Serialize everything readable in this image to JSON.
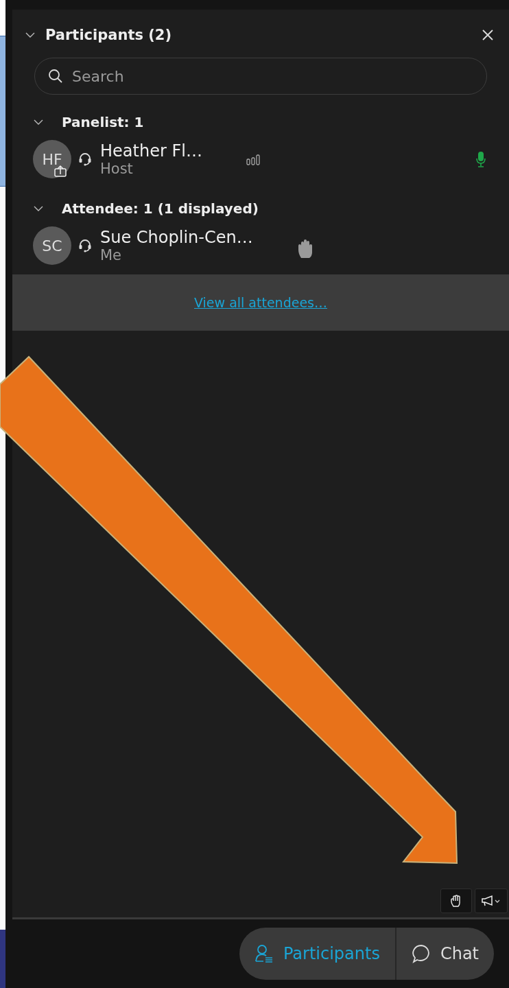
{
  "panel": {
    "title": "Participants (2)",
    "expanded": true
  },
  "search": {
    "placeholder": "Search"
  },
  "groups": [
    {
      "label": "Panelist: 1",
      "expanded": true,
      "members": [
        {
          "initials": "HF",
          "name": "Heather Fl…",
          "role": "Host",
          "sharing": true,
          "network_icon": true,
          "mic_on": true,
          "hand_raised": false
        }
      ]
    },
    {
      "label": "Attendee: 1 (1 displayed)",
      "expanded": true,
      "members": [
        {
          "initials": "SC",
          "name": "Sue Choplin-Cen…",
          "role": "Me",
          "sharing": false,
          "network_icon": false,
          "mic_on": false,
          "hand_raised": true
        }
      ]
    }
  ],
  "view_all_link": "View all attendees…",
  "tabs": [
    {
      "kind": "participants",
      "label": "Participants",
      "selected": true
    },
    {
      "kind": "chat",
      "label": "Chat",
      "selected": false
    }
  ]
}
